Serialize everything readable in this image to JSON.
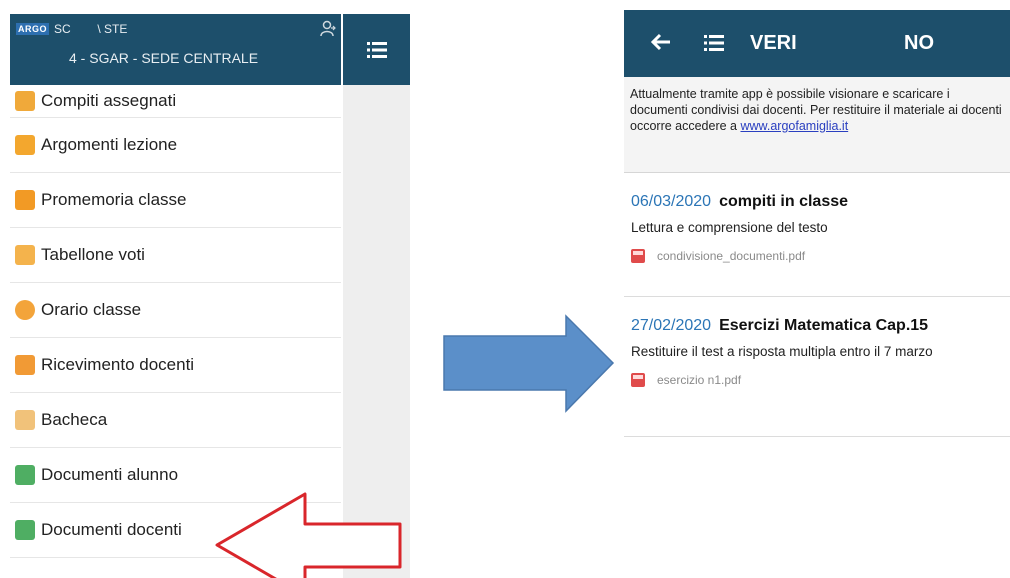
{
  "left": {
    "logo": "ARGO",
    "school": "SC        \\ STE",
    "subtitle": "4 - SGAR - SEDE CENTRALE",
    "menu": [
      {
        "label": "Compiti assegnati",
        "color": "#f0a93a"
      },
      {
        "label": "Argomenti lezione",
        "color": "#f3a72e"
      },
      {
        "label": "Promemoria classe",
        "color": "#f29a25"
      },
      {
        "label": "Tabellone voti",
        "color": "#f4b34c"
      },
      {
        "label": "Orario classe",
        "color": "#f3a43a"
      },
      {
        "label": "Ricevimento docenti",
        "color": "#f19a35"
      },
      {
        "label": "Bacheca",
        "color": "#f1c27a"
      },
      {
        "label": "Documenti alunno",
        "color": "#4fae63"
      },
      {
        "label": "Documenti docenti",
        "color": "#4fae63"
      }
    ]
  },
  "right": {
    "title_left": "VERI",
    "title_right": "NO",
    "notice_text": "Attualmente tramite app è possibile visionare e scaricare i documenti condivisi dai docenti. Per restituire il materiale ai docenti occorre accedere a ",
    "notice_link": "www.argofamiglia.it",
    "documents": [
      {
        "date": "06/03/2020",
        "title": "compiti in classe",
        "description": "Lettura e comprensione del testo",
        "file": "condivisione_documenti.pdf"
      },
      {
        "date": "27/02/2020",
        "title": "Esercizi Matematica Cap.15",
        "description": "Restituire il test a risposta multipla entro il 7 marzo",
        "file": "esercizio n1.pdf"
      }
    ]
  },
  "colors": {
    "header": "#1d4f6b",
    "big_arrow": "#5b8fc9",
    "pointer_arrow": "#d9262b",
    "date": "#2b75b6"
  }
}
